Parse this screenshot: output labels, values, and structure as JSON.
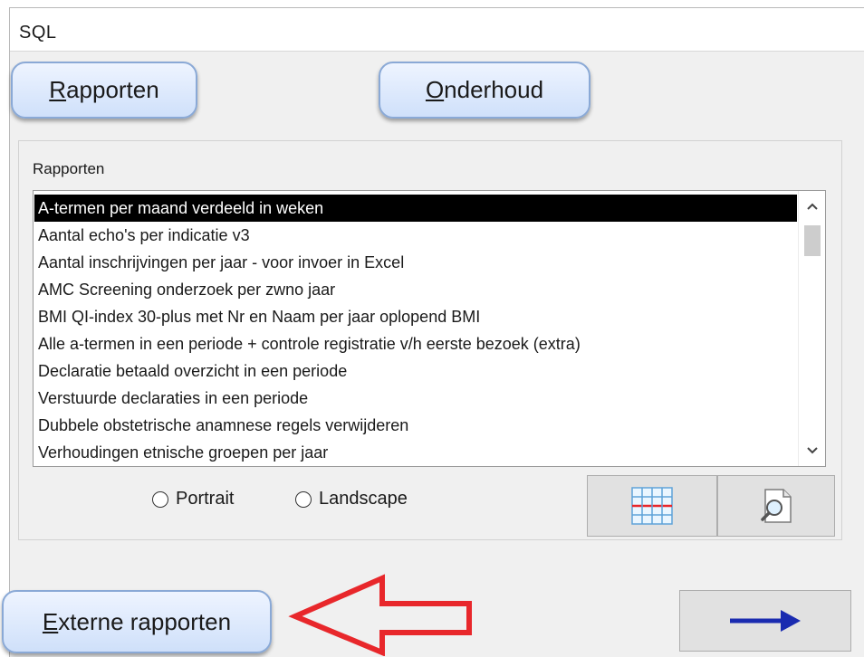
{
  "window": {
    "title": "SQL"
  },
  "top_buttons": {
    "rapporten": {
      "mnemonic": "R",
      "rest": "apporten"
    },
    "onderhoud": {
      "mnemonic": "O",
      "rest": "nderhoud"
    }
  },
  "group": {
    "label": "Rapporten"
  },
  "report_list": {
    "selected_index": 0,
    "items": [
      "A-termen per maand verdeeld in weken",
      "Aantal echo's per indicatie v3",
      "Aantal inschrijvingen per jaar - voor invoer in Excel",
      "AMC Screening onderzoek per zwno jaar",
      "BMI QI-index 30-plus   met Nr en Naam per jaar oplopend BMI",
      "Alle a-termen in een periode + controle registratie v/h eerste bezoek (extra)",
      "Declaratie betaald overzicht in een periode",
      "Verstuurde declaraties in een periode",
      "Dubbele obstetrische anamnese regels verwijderen",
      "Verhoudingen etnische groepen per jaar"
    ]
  },
  "orientation": {
    "portrait": "Portrait",
    "landscape": "Landscape"
  },
  "icons": {
    "grid": "grid-table-icon",
    "preview": "magnifier-document-icon",
    "next": "right-arrow-icon"
  },
  "bottom_buttons": {
    "externe_rapporten": {
      "mnemonic": "E",
      "rest": "xterne rapporten"
    }
  },
  "colors": {
    "selection_bg": "#000000",
    "selection_fg": "#ffffff",
    "arrow_blue": "#1a2bb0",
    "annotation_red": "#e8272b",
    "button_border": "#8aa9d6"
  }
}
